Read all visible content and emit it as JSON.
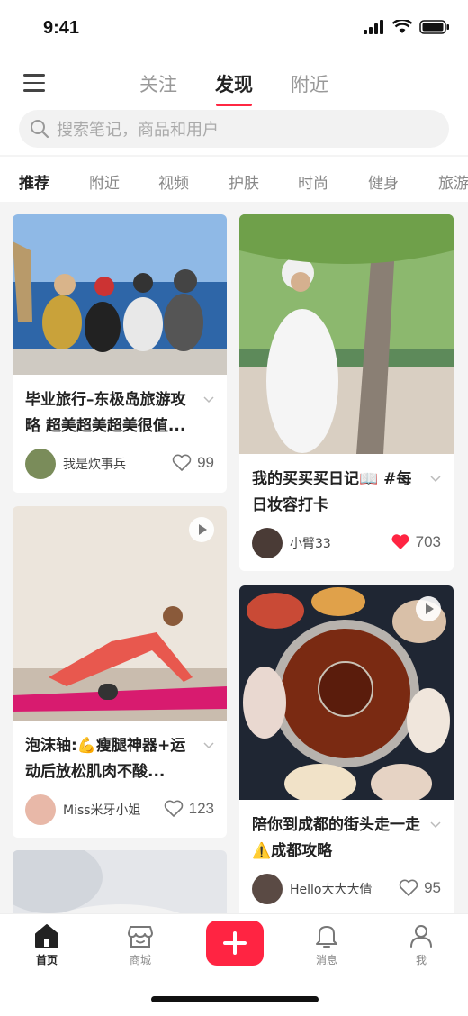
{
  "status": {
    "time": "9:41"
  },
  "top_tabs": [
    "关注",
    "发现",
    "附近"
  ],
  "active_tab_index": 1,
  "search": {
    "placeholder": "搜索笔记，商品和用户"
  },
  "categories": [
    "推荐",
    "附近",
    "视频",
    "护肤",
    "时尚",
    "健身",
    "旅游"
  ],
  "active_category_index": 0,
  "posts": [
    {
      "title": "毕业旅行–东极岛旅游攻略 超美超美超美很值...",
      "author": "我是炊事兵",
      "likes": "99",
      "liked": false
    },
    {
      "title": "我的买买买日记📖 #每日妆容打卡",
      "author": "小臂33",
      "likes": "703",
      "liked": true
    },
    {
      "title": "泡沫轴:💪瘦腿神器+运动后放松肌肉不酸...",
      "author": "Miss米牙小姐",
      "likes": "123",
      "liked": false,
      "video": true
    },
    {
      "title": "陪你到成都的街头走一走⚠️成都攻略",
      "author": "Hello大大大倩",
      "likes": "95",
      "liked": false,
      "video": true
    }
  ],
  "bottom_nav": {
    "home": "首页",
    "mall": "商城",
    "messages": "消息",
    "me": "我"
  },
  "colors": {
    "accent": "#ff2442",
    "like_red": "#ff2442"
  }
}
